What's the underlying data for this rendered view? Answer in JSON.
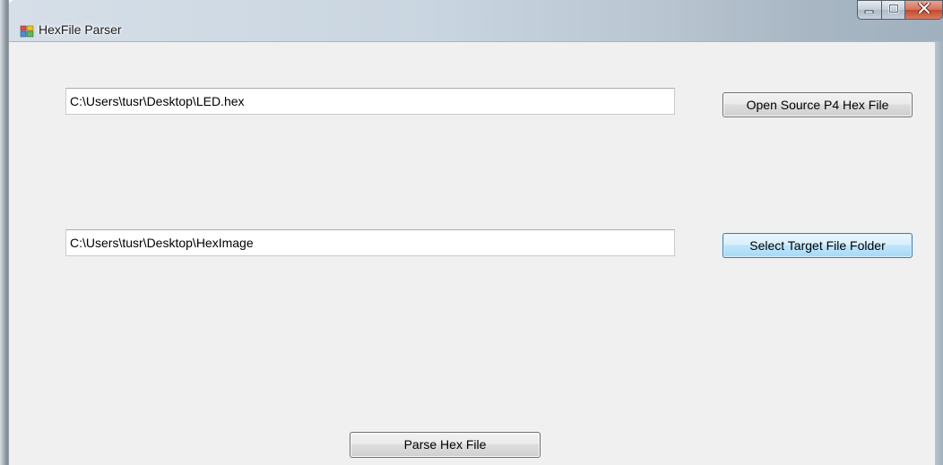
{
  "window": {
    "title": "HexFile Parser"
  },
  "caption_buttons": {
    "minimize_icon": "minimize-icon",
    "maximize_icon": "maximize-icon",
    "close_icon": "close-icon"
  },
  "source": {
    "path_value": "C:\\Users\\tusr\\Desktop\\LED.hex",
    "button_label": "Open Source P4 Hex File"
  },
  "target": {
    "path_value": "C:\\Users\\tusr\\Desktop\\HexImage",
    "button_label": "Select Target File Folder"
  },
  "actions": {
    "parse_label": "Parse Hex File"
  },
  "colors": {
    "client_background": "#f0f0f0",
    "close_button": "#c24a2f",
    "focused_button_border": "#3c7fb1"
  }
}
